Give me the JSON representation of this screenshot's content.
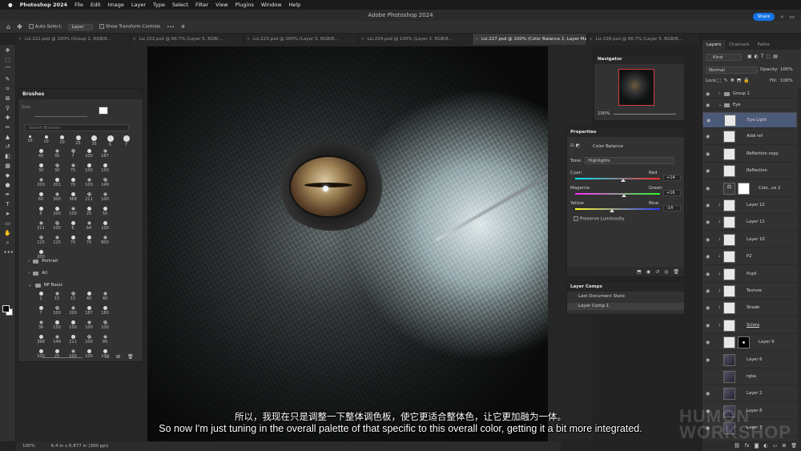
{
  "menubar": {
    "app_name": "Photoshop 2024",
    "items": [
      "File",
      "Edit",
      "Image",
      "Layer",
      "Type",
      "Select",
      "Filter",
      "View",
      "Plugins",
      "Window",
      "Help"
    ]
  },
  "titlebar": {
    "title": "Adobe Photoshop 2024",
    "share_label": "Share"
  },
  "options": {
    "auto_select_label": "Auto-Select:",
    "auto_select_value": "Layer",
    "transform_label": "Show Transform Controls"
  },
  "tabs": [
    "Liz.221.psd @ 100% (Group 1, RGB/8...",
    "Liz.222.psd @ 66.7% (Layer 5, RGB/...",
    "Liz.223.psd @ 200% (Layer 3, RGB/8...",
    "Liz.224.psd @ 100% (Layer 2, RGB/8...",
    "Liz.227.psd @ 100% (Color Balance 2, Layer Mask/8) *",
    "Liz.228.psd @ 66.7% (Layer 5, RGB/8..."
  ],
  "brushes": {
    "title": "Brushes",
    "size_label": "Size:",
    "search_placeholder": "Search Brushes",
    "top_sizes": [
      "16",
      "10",
      "20",
      "25",
      "35",
      "6",
      "7"
    ],
    "grid1": [
      "40",
      "35",
      "7",
      "100",
      "187",
      "30",
      "30",
      "75",
      "100",
      "150",
      "200",
      "201",
      "70",
      "100",
      "149",
      "60",
      "300",
      "368",
      "211",
      "100",
      "8",
      "200",
      "100",
      "25",
      "50",
      "211",
      "100",
      "6",
      "64",
      "100",
      "125",
      "125",
      "70",
      "70",
      "800",
      "200"
    ],
    "folders": [
      "Portrait",
      "All",
      "NP Basic"
    ],
    "grid2": [
      "1",
      "15",
      "15",
      "40",
      "40",
      "7",
      "100",
      "200",
      "187",
      "180",
      "36",
      "150",
      "150",
      "100",
      "100",
      "368",
      "149",
      "211",
      "100",
      "80",
      "100",
      "25",
      "100",
      "100",
      "100"
    ]
  },
  "navigator": {
    "title": "Navigator",
    "zoom": "100%"
  },
  "properties": {
    "title": "Properties",
    "adjustment": "Color Balance",
    "tone_label": "Tone:",
    "tone_value": "Highlights",
    "sliders": [
      {
        "left": "Cyan",
        "right": "Red",
        "value": "+14",
        "pos": 0.57
      },
      {
        "left": "Magenta",
        "right": "Green",
        "value": "+16",
        "pos": 0.58
      },
      {
        "left": "Yellow",
        "right": "Blue",
        "value": "-14",
        "pos": 0.43
      }
    ],
    "preserve_label": "Preserve Luminosity"
  },
  "layer_comps": {
    "title": "Layer Comps",
    "rows": [
      "Last Document State",
      "Layer Comp 1"
    ]
  },
  "layers_panel": {
    "tabs": [
      "Layers",
      "Channels",
      "Paths"
    ],
    "kind_label": "Kind",
    "blend_mode": "Normal",
    "opacity_label": "Opacity:",
    "opacity_value": "100%",
    "lock_label": "Lock:",
    "fill_label": "Fill:",
    "fill_value": "100%",
    "layers": [
      {
        "name": "Group 1",
        "type": "group"
      },
      {
        "name": "Eye",
        "type": "group"
      },
      {
        "name": "Eye Light",
        "type": "layer",
        "selected": true
      },
      {
        "name": "Addi ref",
        "type": "layer"
      },
      {
        "name": "Reflection copy",
        "type": "layer"
      },
      {
        "name": "Reflection",
        "type": "layer"
      },
      {
        "name": "Colo...ce 2",
        "type": "adjust"
      },
      {
        "name": "Layer 12",
        "type": "layer"
      },
      {
        "name": "Layer 11",
        "type": "layer"
      },
      {
        "name": "Layer 10",
        "type": "layer"
      },
      {
        "name": "P2",
        "type": "layer"
      },
      {
        "name": "Pupil",
        "type": "layer"
      },
      {
        "name": "Texture",
        "type": "layer"
      },
      {
        "name": "Shade",
        "type": "layer"
      },
      {
        "name": "Sclera",
        "type": "layer"
      },
      {
        "name": "Layer 9",
        "type": "mask"
      },
      {
        "name": "Layer 6",
        "type": "img"
      },
      {
        "name": "rgba",
        "type": "img"
      },
      {
        "name": "Layer 2",
        "type": "img"
      },
      {
        "name": "Layer 8",
        "type": "img"
      },
      {
        "name": "Layer 7",
        "type": "img"
      }
    ]
  },
  "status": {
    "zoom": "100%",
    "doc_size": "6.4 in x 6.877 in (300 ppi)"
  },
  "subtitles": {
    "cn": "所以，我现在只是调整一下整体调色板，使它更适合整体色，让它更加融为一体。",
    "en": "So now I'm just tuning in the overall palette of that specific to this overall color, getting it a bit more integrated."
  },
  "watermark": {
    "line1": "HUMON",
    "line2": "WORKSHOP"
  }
}
